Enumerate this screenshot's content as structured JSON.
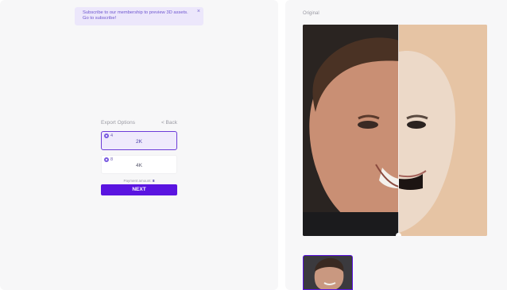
{
  "toast": {
    "line1": "Subscribe to our membership to preview 3D assets.",
    "line2": "Go to subscribe!",
    "close": "×"
  },
  "export": {
    "title": "Export Options",
    "back": "< Back",
    "options": [
      {
        "price": "4",
        "label": "2K",
        "selected": true
      },
      {
        "price": "8",
        "label": "4K",
        "selected": false
      }
    ],
    "payment_label": "Payment amount:",
    "payment_value": "8",
    "next": "NEXT"
  },
  "preview": {
    "label": "Original"
  },
  "colors": {
    "accent": "#5a14e0",
    "toast_bg": "#ece7fb",
    "selected_bg": "#efeafc"
  },
  "icons": [
    "close-icon",
    "coin-icon"
  ]
}
